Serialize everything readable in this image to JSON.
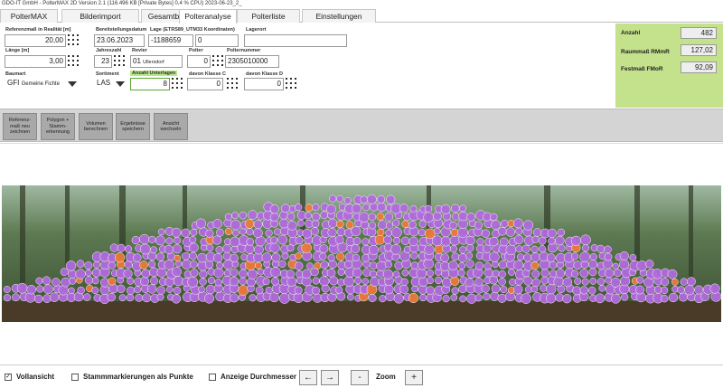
{
  "window": {
    "title": "GDO-IT GmbH - PolterMAX 2D  Version 2.1   (116.496 KB [Private Bytes] 0,4 % CPU)   2023-06-23_2_"
  },
  "tabs": [
    {
      "label": "PolterMAX Menü"
    },
    {
      "label": "Bilderimport"
    },
    {
      "label": "Gesamtbilder"
    },
    {
      "label": "Polteranalyse"
    },
    {
      "label": "Polterliste"
    },
    {
      "label": "Einstellungen"
    }
  ],
  "form": {
    "referenzmass": {
      "label": "Referenzmaß in Realität [m]",
      "value": "20,00"
    },
    "laenge": {
      "label": "Länge [m]",
      "value": "3,00"
    },
    "baumart": {
      "label": "Baumart",
      "code": "GFI",
      "name": "Gemeine Fichte"
    },
    "bereitstellungsdatum": {
      "label": "Bereitstellungsdatum",
      "value": "23.06.2023"
    },
    "jahreszahl": {
      "label": "Jahreszahl",
      "value": "23"
    },
    "sortiment": {
      "label": "Sortiment",
      "value": "LAS"
    },
    "lage": {
      "label": "Lage (ETRS89_UTM33 Koordinaten)",
      "x": "-1188659",
      "y": "0"
    },
    "revier": {
      "label": "Revier",
      "code": "01",
      "name": "Ullersdorf"
    },
    "anzahl_unterlagen": {
      "label": "Anzahl Unterlagen",
      "value": "8"
    },
    "polter": {
      "label": "Polter",
      "value": "0"
    },
    "klasse_c": {
      "label": "davon Klasse C",
      "value": "0"
    },
    "lagerort": {
      "label": "Lagerort",
      "value": ""
    },
    "polternummer": {
      "label": "Polternummer",
      "value": "2305010000"
    },
    "klasse_d": {
      "label": "davon Klasse D",
      "value": "0"
    }
  },
  "summary": {
    "anzahl": {
      "label": "Anzahl",
      "value": "482"
    },
    "raummass": {
      "label": "Raummaß RMmR",
      "value": "127,02"
    },
    "festmass": {
      "label": "Festmaß FMoR",
      "value": "92,09"
    }
  },
  "toolbar": [
    {
      "label": "Referenz-maß neu zeichnen"
    },
    {
      "label": "Polygon + Stamm-erkennung"
    },
    {
      "label": "Volumen berechnen"
    },
    {
      "label": "Ergebnisse speichern"
    },
    {
      "label": "Ansicht wechseln"
    }
  ],
  "bottom": {
    "vollansicht": {
      "label": "Vollansicht",
      "checked": true
    },
    "stammmarkierungen": {
      "label": "Stammmarkierungen als Punkte",
      "checked": false
    },
    "durchmesser": {
      "label": "Anzeige Durchmesser",
      "checked": false
    },
    "prev": "←",
    "next": "→",
    "zoom_out": "-",
    "zoom_label": "Zoom",
    "zoom_in": "+"
  },
  "colors": {
    "summary_bg": "#c4e18c",
    "log_marker": "#b36be0",
    "log_marker_orange": "#f07a3a",
    "toolbar_bg": "#d4d4d4",
    "active_field_border": "#5aa832"
  }
}
